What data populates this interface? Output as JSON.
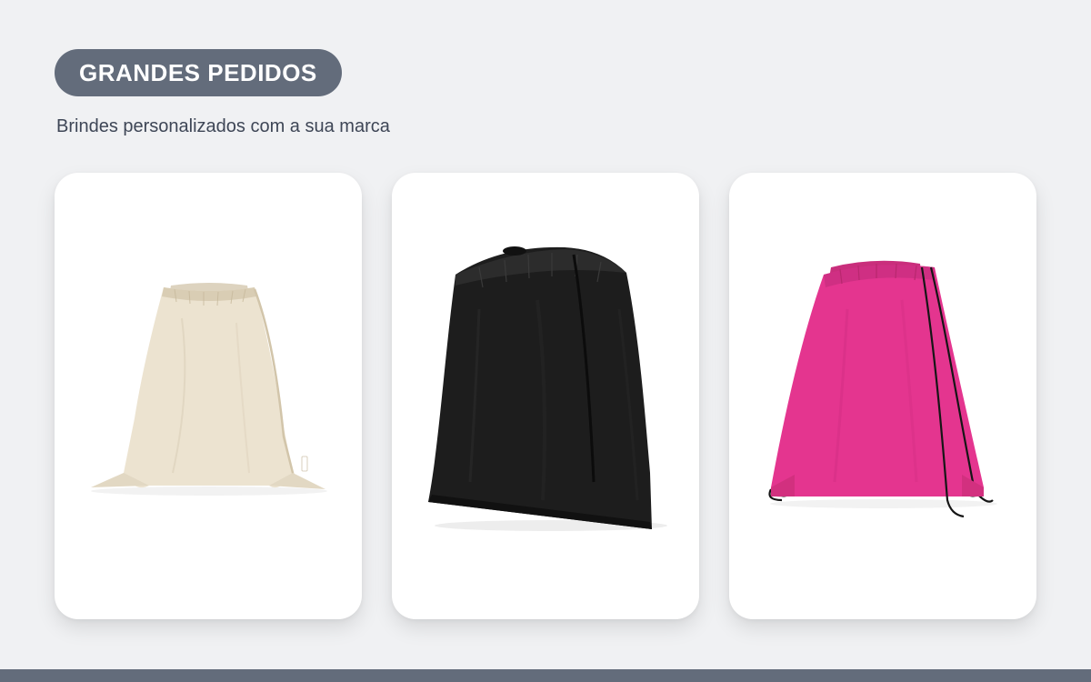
{
  "header": {
    "badge_label": "GRANDES PEDIDOS",
    "subtitle": "Brindes personalizados com a sua marca"
  },
  "products": [
    {
      "image": "beige-drawstring-bag-image",
      "color": "#ece3d0"
    },
    {
      "image": "black-drawstring-bag-image",
      "color": "#1c1c1c"
    },
    {
      "image": "pink-drawstring-bag-image",
      "color": "#e4358f"
    }
  ],
  "colors": {
    "background": "#f0f1f3",
    "accent": "#636c7b",
    "subtitle_text": "#3e4656",
    "card": "#ffffff"
  }
}
